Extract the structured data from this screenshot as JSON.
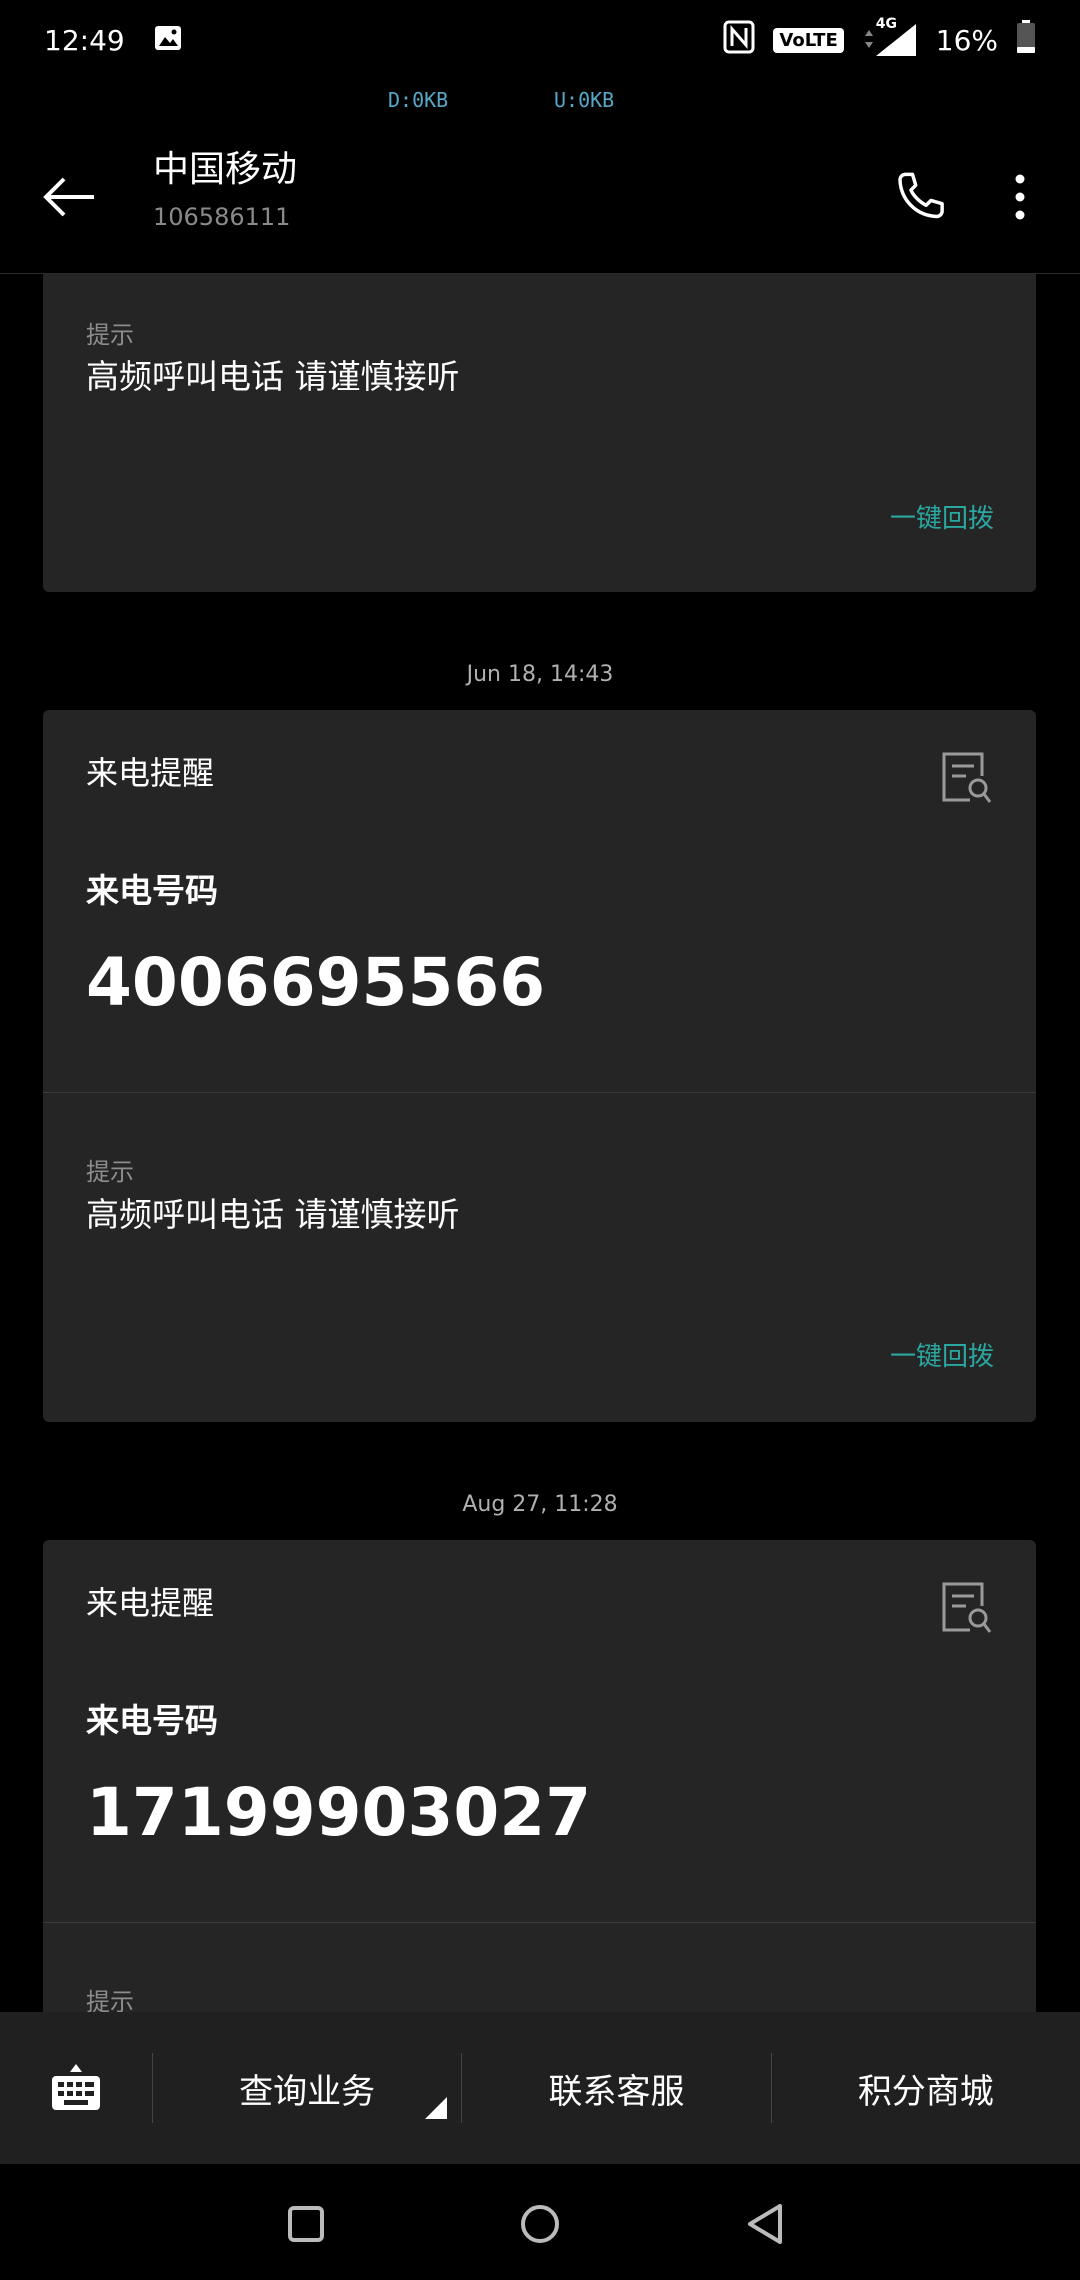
{
  "status_bar": {
    "time": "12:49",
    "volte": "VoLTE",
    "network": "4G",
    "battery": "16%",
    "download_speed": "D:0KB",
    "upload_speed": "U:0KB"
  },
  "header": {
    "title": "中国移动",
    "subtitle": "106586111"
  },
  "messages": {
    "card1": {
      "hint_label": "提示",
      "hint_text": "高频呼叫电话 请谨慎接听",
      "callback": "一键回拨"
    },
    "ts2": "Jun 18, 14:43",
    "card2": {
      "head": "来电提醒",
      "caller_label": "来电号码",
      "caller_number": "4006695566",
      "hint_label": "提示",
      "hint_text": "高频呼叫电话 请谨慎接听",
      "callback": "一键回拨"
    },
    "ts3": "Aug 27, 11:28",
    "card3": {
      "head": "来电提醒",
      "caller_label": "来电号码",
      "caller_number": "17199903027",
      "hint_label": "提示"
    }
  },
  "bottom_menu": {
    "items": [
      "查询业务",
      "联系客服",
      "积分商城"
    ]
  },
  "colors": {
    "background": "#000000",
    "card": "#252525",
    "accent_link": "#2aa7a0",
    "net_speed": "#56a8c9"
  }
}
